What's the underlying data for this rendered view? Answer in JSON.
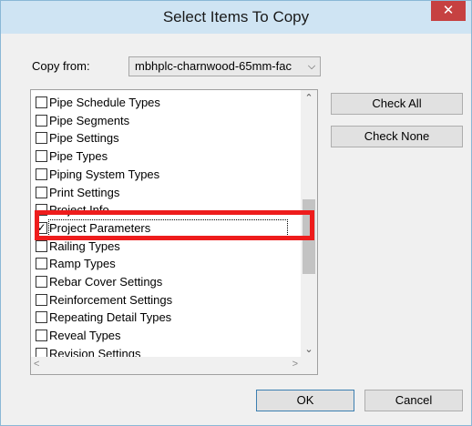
{
  "window": {
    "title": "Select Items To Copy",
    "close_glyph": "✕"
  },
  "copy_from": {
    "label": "Copy from:",
    "value": "mbhplc-charnwood-65mm-fac",
    "dropdown_glyph": "⌵"
  },
  "items": [
    {
      "label": "Pipe Schedule Types",
      "checked": false
    },
    {
      "label": "Pipe Segments",
      "checked": false
    },
    {
      "label": "Pipe Settings",
      "checked": false
    },
    {
      "label": "Pipe Types",
      "checked": false
    },
    {
      "label": "Piping System Types",
      "checked": false
    },
    {
      "label": "Print Settings",
      "checked": false
    },
    {
      "label": "Project Info",
      "checked": false
    },
    {
      "label": "Project Parameters",
      "checked": true,
      "selected": true
    },
    {
      "label": "Railing Types",
      "checked": false
    },
    {
      "label": "Ramp Types",
      "checked": false
    },
    {
      "label": "Rebar Cover Settings",
      "checked": false
    },
    {
      "label": "Reinforcement Settings",
      "checked": false
    },
    {
      "label": "Repeating Detail Types",
      "checked": false
    },
    {
      "label": "Reveal Types",
      "checked": false
    },
    {
      "label": "Revision Settings",
      "checked": false
    }
  ],
  "check_glyph": "✓",
  "buttons": {
    "check_all": "Check All",
    "check_none": "Check None",
    "ok": "OK",
    "cancel": "Cancel"
  },
  "scroll_glyphs": {
    "up": "⌃",
    "down": "⌄",
    "left": "<",
    "right": ">"
  },
  "colors": {
    "title_bar": "#cfe4f3",
    "close_button": "#c64141",
    "highlight_box": "#ee1c1c"
  }
}
